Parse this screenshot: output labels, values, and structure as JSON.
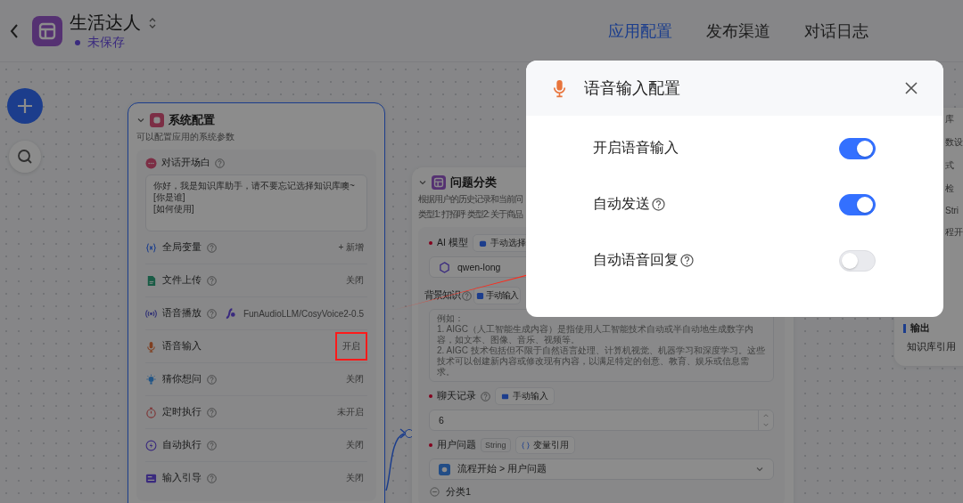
{
  "header": {
    "app_name": "生活达人",
    "status": "未保存",
    "tabs": [
      {
        "label": "应用配置",
        "selected": true
      },
      {
        "label": "发布渠道",
        "selected": false
      },
      {
        "label": "对话日志",
        "selected": false
      }
    ]
  },
  "system_node": {
    "title": "系统配置",
    "subtitle": "可以配置应用的系统参数",
    "opening": {
      "label": "对话开场白",
      "lines": [
        "你好，我是知识库助手，请不要忘记选择知识库噢~",
        "[你是谁]",
        "[如何使用]"
      ]
    },
    "rows": [
      {
        "kind": "variable",
        "label": "全局变量",
        "help": true,
        "value": "+ 新增",
        "highlighted": false
      },
      {
        "kind": "file",
        "label": "文件上传",
        "help": true,
        "value": "关闭",
        "highlighted": false
      },
      {
        "kind": "tts",
        "label": "语音播放",
        "help": true,
        "value": "FunAudioLLM/CosyVoice2-0.5",
        "highlighted": false
      },
      {
        "kind": "mic",
        "label": "语音输入",
        "help": false,
        "value": "开启",
        "highlighted": true
      },
      {
        "kind": "bulb",
        "label": "猜你想问",
        "help": true,
        "value": "关闭",
        "highlighted": false
      },
      {
        "kind": "timer",
        "label": "定时执行",
        "help": true,
        "value": "未开启",
        "highlighted": false
      },
      {
        "kind": "auto",
        "label": "自动执行",
        "help": true,
        "value": "关闭",
        "highlighted": false
      },
      {
        "kind": "guide",
        "label": "输入引导",
        "help": true,
        "value": "关闭",
        "highlighted": false
      }
    ]
  },
  "classify_node": {
    "title": "问题分类",
    "description": [
      "根据用户的历史记录和当前问",
      "类型1: 打招呼 类型2: 关于商品"
    ],
    "model": {
      "label": "AI 模型",
      "mode": "手动选择",
      "value": "qwen-long"
    },
    "background": {
      "label": "背景知识",
      "mode": "手动输入",
      "lines": [
        "例如：",
        "1. AIGC（人工智能生成内容）是指使用人工智能技术自动或半自动地生成数字内容，如文本、图像、音乐、视频等。",
        "2. AIGC 技术包括但不限于自然语言处理、计算机视觉、机器学习和深度学习。这些技术可以创建新内容或修改现有内容，以满足特定的创意、教育、娱乐或信息需求。"
      ]
    },
    "history": {
      "label": "聊天记录",
      "mode": "手动输入",
      "value": "6"
    },
    "question": {
      "label": "用户问题",
      "type": "String",
      "mode": "变量引用",
      "value": "流程开始 > 用户问题"
    },
    "class_label": "分类1"
  },
  "right_node": {
    "top_texts": [
      "库",
      "数设",
      "式",
      "检",
      "Stri",
      "程开"
    ],
    "output_label": "输出",
    "reference_label": "知识库引用"
  },
  "modal": {
    "title": "语音输入配置",
    "toggles": [
      {
        "label": "开启语音输入",
        "help": false,
        "on": true
      },
      {
        "label": "自动发送",
        "help": true,
        "on": true
      },
      {
        "label": "自动语音回复",
        "help": true,
        "on": false
      }
    ]
  }
}
